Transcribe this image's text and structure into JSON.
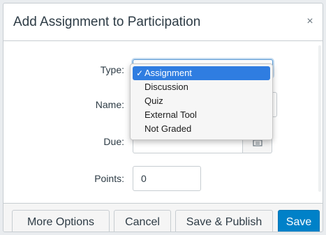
{
  "dialog": {
    "title": "Add Assignment to Participation",
    "close_glyph": "×"
  },
  "form": {
    "type_label": "Type:",
    "name_label": "Name:",
    "due_label": "Due:",
    "points_label": "Points:",
    "points_value": "0",
    "calendar_icon": "calendar-icon"
  },
  "type_dropdown": {
    "selected": "Assignment",
    "check_glyph": "✓",
    "options": [
      "Assignment",
      "Discussion",
      "Quiz",
      "External Tool",
      "Not Graded"
    ]
  },
  "footer": {
    "more_options": "More Options",
    "cancel": "Cancel",
    "save_publish": "Save & Publish",
    "save": "Save"
  },
  "colors": {
    "primary": "#0081c8",
    "selection": "#2f7de1"
  }
}
